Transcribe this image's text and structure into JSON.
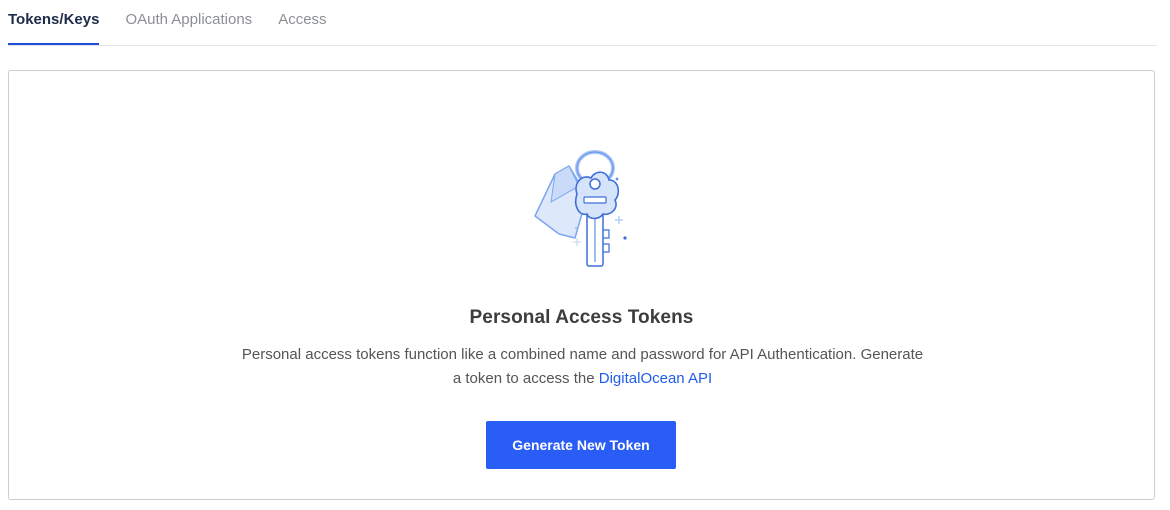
{
  "tabs": [
    {
      "label": "Tokens/Keys",
      "active": true
    },
    {
      "label": "OAuth Applications",
      "active": false
    },
    {
      "label": "Access",
      "active": false
    }
  ],
  "empty_state": {
    "icon": "key-with-tag-icon",
    "title": "Personal Access Tokens",
    "description_line1": "Personal access tokens function like a combined name and password for API Authentication. Generate",
    "description_line2_prefix": "a token to access the",
    "description_link": "DigitalOcean API",
    "button_label": "Generate New Token"
  },
  "colors": {
    "accent": "#2a5cf6",
    "link": "#1f5dec",
    "active_tab_text": "#1e2b49",
    "inactive_tab_text": "#8c8f94",
    "illustration_blue": "#5b8def"
  }
}
